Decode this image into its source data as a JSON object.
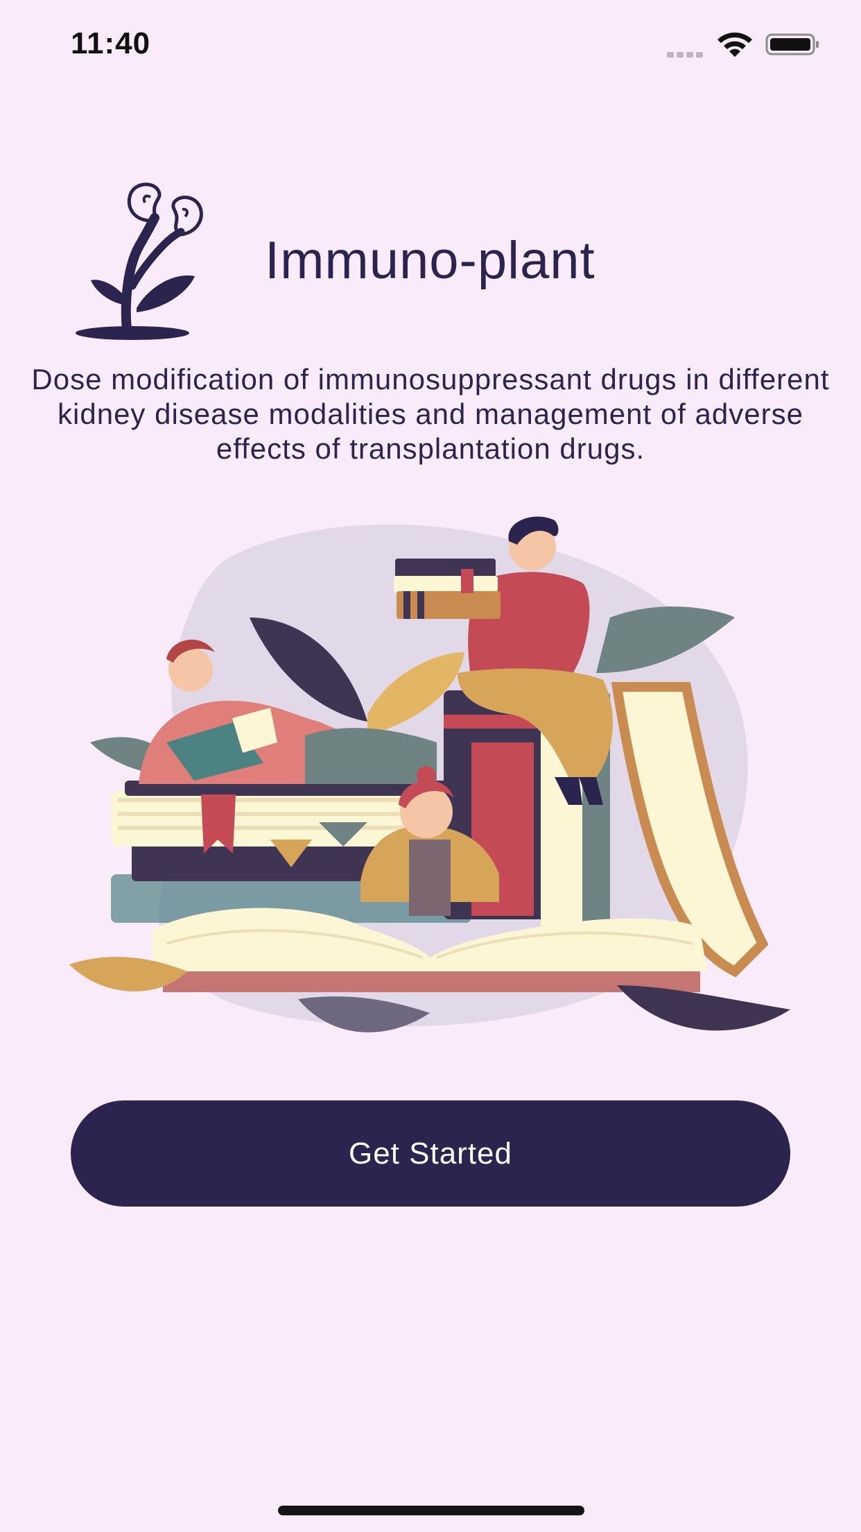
{
  "status_bar": {
    "time": "11:40",
    "icons": [
      "cellular-signal-icon",
      "wifi-icon",
      "battery-icon"
    ]
  },
  "header": {
    "logo_icon": "kidney-plant-logo-icon",
    "title": "Immuno-plant"
  },
  "main": {
    "tagline": "Dose modification of immunosuppressant drugs in different kidney disease modalities and management of adverse effects of transplantation drugs.",
    "illustration": "people-reading-books-illustration"
  },
  "actions": {
    "get_started_label": "Get Started"
  },
  "colors": {
    "background": "#FAEBFB",
    "primary": "#2A244F",
    "button_text": "#FFFFFF"
  }
}
